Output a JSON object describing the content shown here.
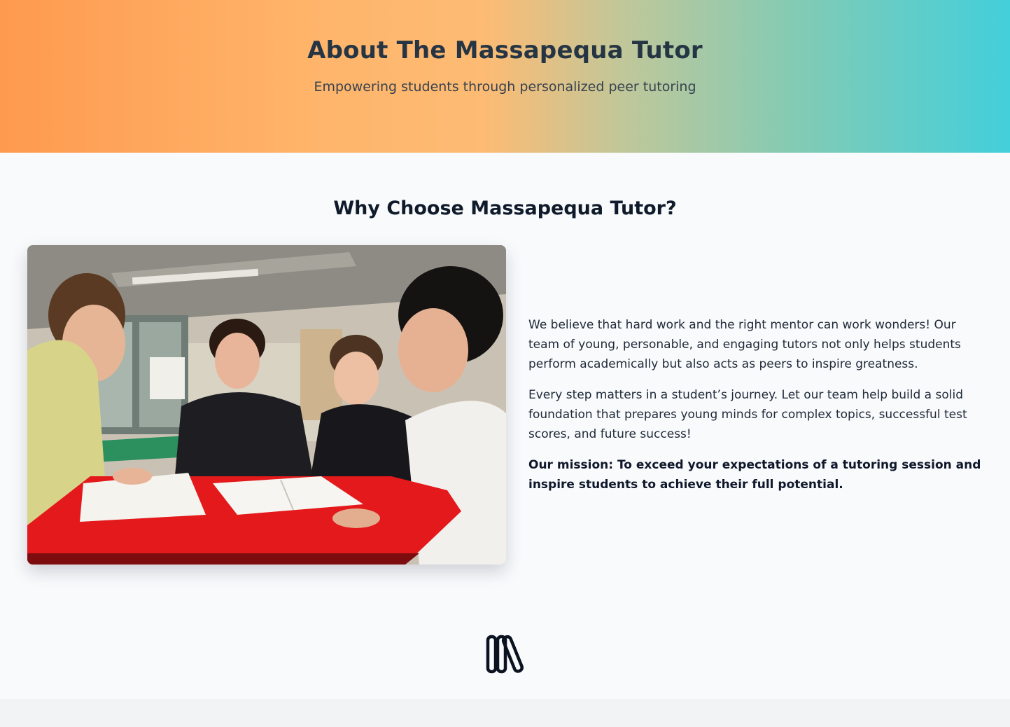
{
  "hero": {
    "title": "About The Massapequa Tutor",
    "subtitle": "Empowering students through personalized peer tutoring"
  },
  "about": {
    "heading": "Why Choose Massapequa Tutor?",
    "paragraph_1": "We believe that hard work and the right mentor can work wonders! Our team of young, personable, and engaging tutors not only helps students perform academically but also acts as peers to inspire greatness.",
    "paragraph_2": "Every step matters in a student’s journey. Let our team help build a solid foundation that prepares young minds for complex topics, successful test scores, and future success!",
    "mission": "Our mission: To exceed your expectations of a tutoring session and inspire students to achieve their full potential."
  },
  "icons": {
    "footer_logo": "books-library-icon"
  },
  "colors": {
    "hero_gradient_start": "#fe9a4f",
    "hero_gradient_end": "#43cfdb",
    "page_background": "#f8fafc",
    "heading_text": "#0f1a2a"
  }
}
